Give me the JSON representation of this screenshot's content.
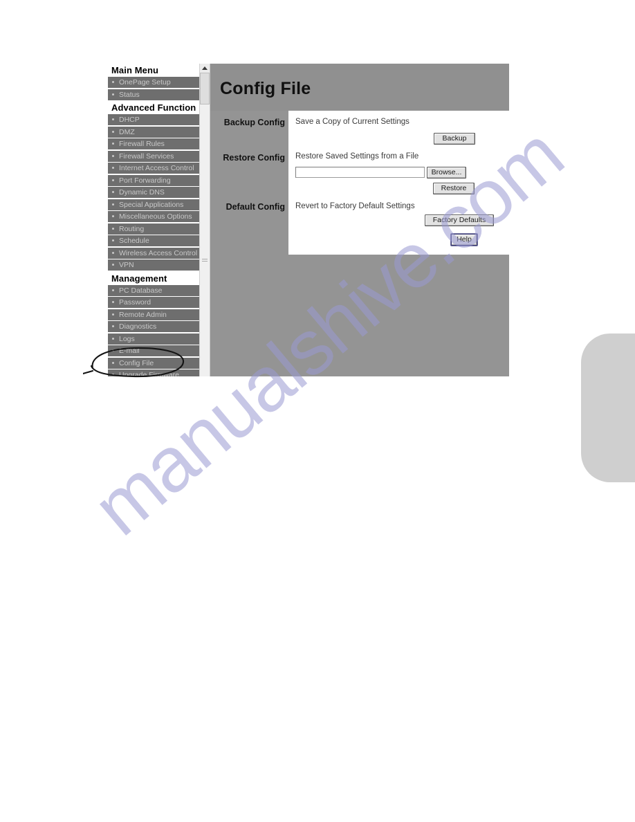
{
  "watermark": {
    "text": "manualshive.com"
  },
  "sidebar": {
    "groups": [
      {
        "heading": "Main Menu",
        "items": [
          {
            "label": "OnePage Setup"
          },
          {
            "label": "Status"
          }
        ]
      },
      {
        "heading": "Advanced Function",
        "items": [
          {
            "label": "DHCP"
          },
          {
            "label": "DMZ"
          },
          {
            "label": "Firewall Rules"
          },
          {
            "label": "Firewall Services"
          },
          {
            "label": "Internet Access Control"
          },
          {
            "label": "Port Forwarding"
          },
          {
            "label": "Dynamic DNS"
          },
          {
            "label": "Special Applications"
          },
          {
            "label": "Miscellaneous Options"
          },
          {
            "label": "Routing"
          },
          {
            "label": "Schedule"
          },
          {
            "label": "Wireless Access Control"
          },
          {
            "label": "VPN"
          }
        ]
      },
      {
        "heading": "Management",
        "items": [
          {
            "label": "PC Database"
          },
          {
            "label": "Password"
          },
          {
            "label": "Remote Admin"
          },
          {
            "label": "Diagnostics"
          },
          {
            "label": "Logs"
          },
          {
            "label": "E-mail"
          },
          {
            "label": "Config File"
          },
          {
            "label": "Upgrade Firmware"
          }
        ]
      }
    ],
    "scrollbar": {
      "up_arrow": "scroll-up-arrow"
    }
  },
  "page": {
    "title": "Config File"
  },
  "sections": {
    "backup": {
      "label": "Backup Config",
      "description": "Save a Copy of Current Settings",
      "button": "Backup"
    },
    "restore": {
      "label": "Restore Config",
      "description": "Restore Saved Settings from a File",
      "file_value": "",
      "file_placeholder": "",
      "browse_button": "Browse...",
      "button": "Restore"
    },
    "defaults": {
      "label": "Default Config",
      "description": "Revert to Factory Default Settings",
      "button": "Factory Defaults"
    },
    "help": {
      "button": "Help"
    }
  },
  "annotation": {
    "type": "hand-drawn-ellipse",
    "targets": "Config File"
  },
  "colors": {
    "content_bg": "#949494",
    "header_bg": "#909090",
    "menu_item_bg": "#6e6e6e",
    "menu_item_text": "#c9c9c9",
    "panel_bg": "#ffffff",
    "watermark": "#9a9ad2",
    "thumb_tab": "#cfcfcf"
  }
}
